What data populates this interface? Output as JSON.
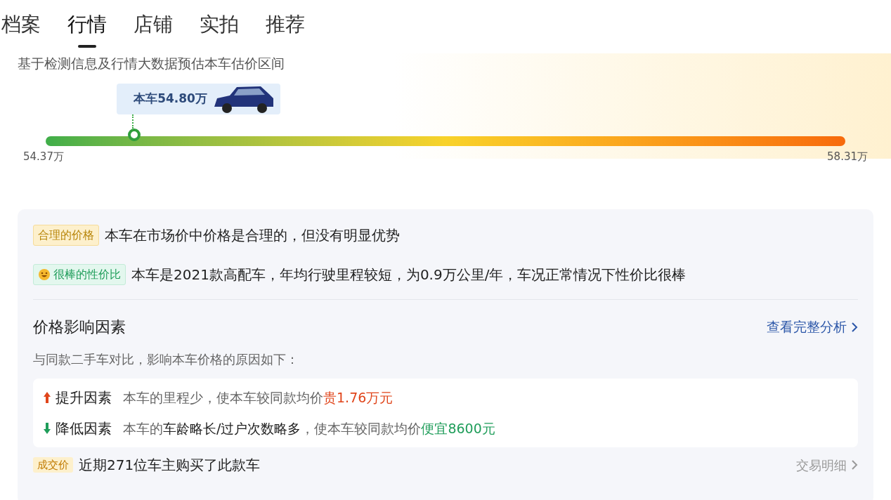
{
  "tabs": [
    {
      "label": "档案",
      "selected": false
    },
    {
      "label": "行情",
      "selected": true
    },
    {
      "label": "店铺",
      "selected": false
    },
    {
      "label": "实拍",
      "selected": false
    },
    {
      "label": "推荐",
      "selected": false
    }
  ],
  "estimate": {
    "caption": "基于检测信息及行情大数据预估本车估价区间",
    "price_tag": "本车54.80万",
    "level": 0.11,
    "min": "54.37万",
    "max": "58.31万"
  },
  "verdicts": [
    {
      "kind": "price",
      "tag": "合理的价格",
      "text": "本车在市场价中价格是合理的，但没有明显优势"
    },
    {
      "kind": "value",
      "tag": "很棒的性价比",
      "text": "本车是2021款高配车，年均行驶里程较短，为0.9万公里/年，车况正常情况下性价比很棒"
    }
  ],
  "factors": {
    "title": "价格影响因素",
    "link": "查看完整分析",
    "subtitle": "与同款二手车对比，影响本车价格的原因如下：",
    "items": [
      {
        "kind": "up",
        "label": "提升因素",
        "text": "本车的里程少，使本车较同款均价",
        "highlight": "贵1.76万元"
      },
      {
        "kind": "down",
        "label": "降低因素",
        "text": "本车的**车龄略长/过户次数略多**，使本车较同款均价",
        "highlight": "便宜8600元"
      }
    ]
  },
  "deals": {
    "tag": "成交价",
    "text": "近期271位车主购买了此款车",
    "link": "交易明细"
  }
}
